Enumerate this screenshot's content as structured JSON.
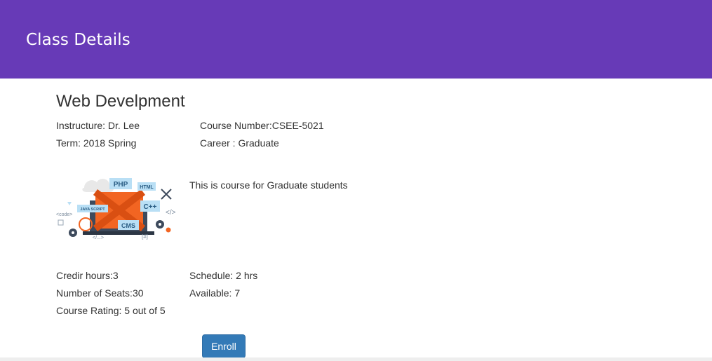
{
  "header": {
    "title": "Class Details"
  },
  "course": {
    "title": "Web Develpment",
    "instructor": "Instructure: Dr. Lee",
    "course_number": "Course Number:CSEE-5021",
    "term": "Term: 2018 Spring",
    "career": "Career : Graduate",
    "description": "This is course for Graduate students",
    "credit_hours": "Credir hours:3",
    "schedule": "Schedule: 2 hrs",
    "seats": "Number of Seats:30",
    "available": "Available: 7",
    "rating": "Course Rating: 5 out of 5",
    "image": {
      "labels": [
        "PHP",
        "HTML",
        "JAVA SCRIPT",
        "C++",
        "CMS",
        "<code>",
        "</>",
        "</...>",
        "[#]"
      ]
    }
  },
  "actions": {
    "enroll_label": "Enroll"
  },
  "colors": {
    "header_bg": "#673ab7",
    "button_bg": "#337ab7",
    "illustration_orange": "#f26522"
  }
}
